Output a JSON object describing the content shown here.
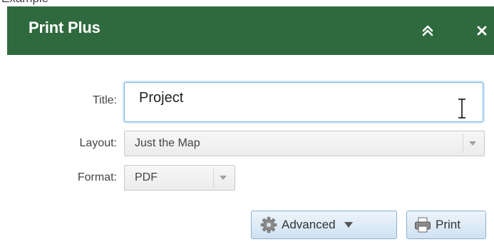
{
  "caption": "Example",
  "panel": {
    "title": "Print Plus"
  },
  "icons": {
    "collapse": "double-chevron-up-icon",
    "close": "close-icon",
    "cursor": "text-cursor-icon",
    "dropdown": "dropdown-arrow-icon",
    "advanced": "gear-icon",
    "print": "printer-icon"
  },
  "form": {
    "title_label": "Title:",
    "title_value": "Project",
    "layout_label": "Layout:",
    "layout_value": "Just the Map",
    "format_label": "Format:",
    "format_value": "PDF"
  },
  "buttons": {
    "advanced_label": "Advanced",
    "print_label": "Print"
  },
  "colors": {
    "header_bg": "#2f6a3f",
    "header_text": "#ffffff",
    "input_focus": "#7fb6e6"
  }
}
